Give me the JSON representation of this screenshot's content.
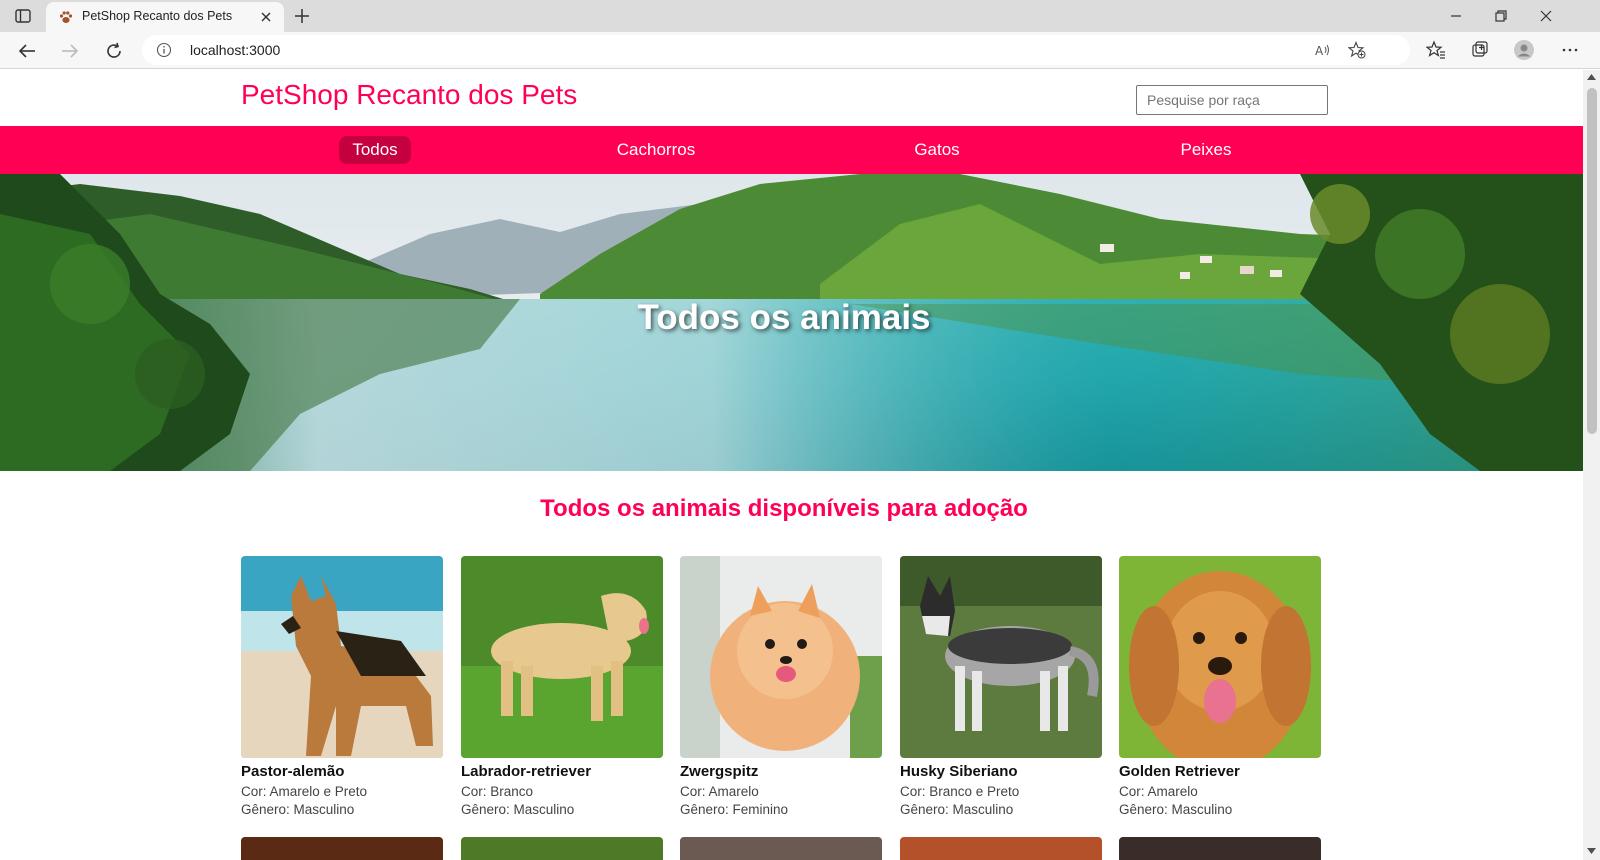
{
  "browser": {
    "tab_title": "PetShop Recanto dos Pets",
    "url": "localhost:3000"
  },
  "site": {
    "title": "PetShop Recanto dos Pets",
    "search_placeholder": "Pesquise por raça",
    "nav": [
      {
        "label": "Todos",
        "active": true
      },
      {
        "label": "Cachorros",
        "active": false
      },
      {
        "label": "Gatos",
        "active": false
      },
      {
        "label": "Peixes",
        "active": false
      }
    ],
    "hero_title": "Todos os animais",
    "section_title": "Todos os animais disponíveis para adoção",
    "pets": [
      {
        "name": "Pastor-alemão",
        "color": "Cor: Amarelo e Preto",
        "gender": "Gênero: Masculino"
      },
      {
        "name": "Labrador-retriever",
        "color": "Cor: Branco",
        "gender": "Gênero: Masculino"
      },
      {
        "name": "Zwergspitz",
        "color": "Cor: Amarelo",
        "gender": "Gênero: Feminino"
      },
      {
        "name": "Husky Siberiano",
        "color": "Cor: Branco e Preto",
        "gender": "Gênero: Masculino"
      },
      {
        "name": "Golden Retriever",
        "color": "Cor: Amarelo",
        "gender": "Gênero: Masculino"
      }
    ]
  },
  "colors": {
    "brand": "#ff0055",
    "brand_active": "#c4003f"
  },
  "icons": [
    "sidebar-toggle-icon",
    "paw-icon",
    "close-icon",
    "plus-icon",
    "minimize-icon",
    "restore-icon",
    "back-icon",
    "forward-icon",
    "refresh-icon",
    "info-icon",
    "read-aloud-icon",
    "add-favorite-icon",
    "favorites-icon",
    "collections-icon",
    "profile-icon",
    "more-icon"
  ]
}
